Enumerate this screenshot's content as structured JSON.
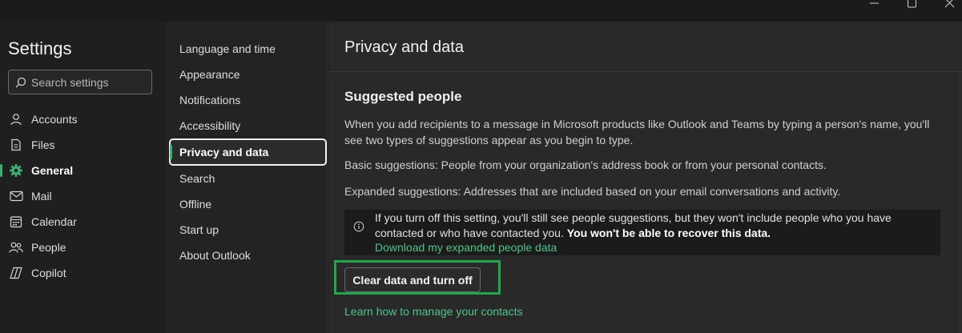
{
  "window": {
    "controls": [
      "minimize-icon",
      "maximize-icon",
      "close-icon"
    ]
  },
  "sidebar": {
    "title": "Settings",
    "search_placeholder": "Search settings",
    "items": [
      {
        "label": "Accounts",
        "icon": "person-icon"
      },
      {
        "label": "Files",
        "icon": "document-icon"
      },
      {
        "label": "General",
        "icon": "gear-icon",
        "active": true
      },
      {
        "label": "Mail",
        "icon": "mail-icon"
      },
      {
        "label": "Calendar",
        "icon": "calendar-icon"
      },
      {
        "label": "People",
        "icon": "people-icon"
      },
      {
        "label": "Copilot",
        "icon": "copilot-icon"
      }
    ]
  },
  "submenu": {
    "items": [
      {
        "label": "Language and time"
      },
      {
        "label": "Appearance"
      },
      {
        "label": "Notifications"
      },
      {
        "label": "Accessibility"
      },
      {
        "label": "Privacy and data",
        "active": true
      },
      {
        "label": "Search"
      },
      {
        "label": "Offline"
      },
      {
        "label": "Start up"
      },
      {
        "label": "About Outlook"
      }
    ]
  },
  "content": {
    "title": "Privacy and data",
    "section_title": "Suggested people",
    "para1": "When you add recipients to a message in Microsoft products like Outlook and Teams by typing a person's name, you'll see two types of suggestions appear as you begin to type.",
    "para2": "Basic suggestions: People from your organization's address book or from your personal contacts.",
    "para3": "Expanded suggestions: Addresses that are included based on your email conversations and activity.",
    "notice": {
      "text": "If you turn off this setting, you'll still see people suggestions, but they won't include people who you have contacted or who have contacted you.",
      "bold": "You won't be able to recover this data.",
      "link": "Download my expanded people data"
    },
    "clear_button": "Clear data and turn off",
    "learn_link": "Learn how to manage your contacts"
  },
  "colors": {
    "accent": "#3ab073",
    "link": "#4fc38a",
    "highlight": "#1fa84a"
  }
}
